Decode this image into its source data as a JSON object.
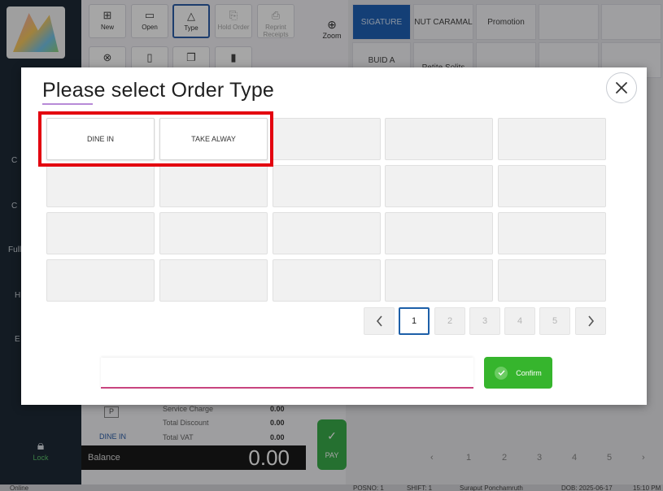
{
  "background": {
    "tools_row1": [
      {
        "label": "New",
        "icon": "new-doc-icon",
        "glyph": "⊞"
      },
      {
        "label": "Open",
        "icon": "folder-icon",
        "glyph": "▭"
      },
      {
        "label": "Type",
        "icon": "shapes-icon",
        "glyph": "△"
      },
      {
        "label": "Hold Order",
        "icon": "hold-icon",
        "glyph": "⎘"
      },
      {
        "label": "Reprint Receipts",
        "icon": "printer-icon",
        "glyph": "⎙"
      }
    ],
    "tools_row2": [
      {
        "icon": "cancel-circle-icon",
        "glyph": "⊗"
      },
      {
        "icon": "trash-icon",
        "glyph": "▯"
      },
      {
        "icon": "copy-icon",
        "glyph": "❐"
      },
      {
        "icon": "chart-icon",
        "glyph": "▮"
      }
    ],
    "zoom_label": "Zoom",
    "categories": [
      "SIGATURE",
      "NUT CARAMAL",
      "Promotion",
      "BUID A",
      "Petite Solits"
    ],
    "side_items": [
      "C",
      "C",
      "Full",
      "H",
      "E"
    ],
    "lock_label": "Lock",
    "summary": {
      "service_charge_label": "Service Charge",
      "service_charge_value": "0.00",
      "total_discount_label": "Total Discount",
      "total_discount_value": "0.00",
      "total_vat_label": "Total VAT",
      "total_vat_value": "0.00",
      "order_type": "DINE IN",
      "balance_label": "Balance",
      "balance_value": "0.00",
      "pay_label": "PAY"
    },
    "pager": [
      "1",
      "2",
      "3",
      "4",
      "5"
    ],
    "status": [
      "Online",
      "POSNO: 1",
      "SHIFT: 1",
      "Suraput Ponchamruth",
      "DOB: 2025-06-17",
      "15:10 PM"
    ]
  },
  "modal": {
    "title": "Please select Order Type",
    "options": [
      "DINE IN",
      "TAKE ALWAY"
    ],
    "pages": [
      "1",
      "2",
      "3",
      "4",
      "5"
    ],
    "current_page": "1",
    "input_placeholder": "",
    "confirm_label": "Confirm"
  },
  "colors": {
    "highlight": "#e3000f",
    "confirm": "#36b52d",
    "current_page_border": "#1d5fa8",
    "input_underline": "#c9447f",
    "title_underline": "#b78ad7"
  }
}
